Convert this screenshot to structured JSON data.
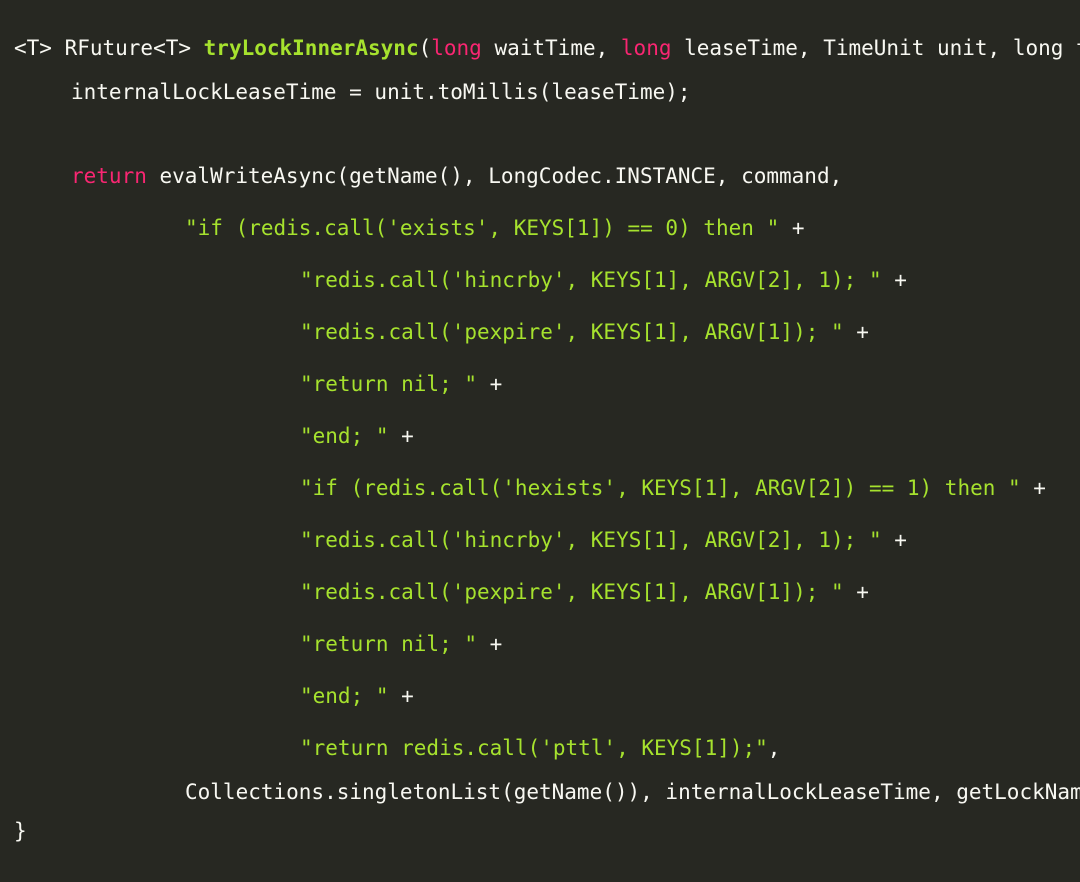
{
  "colors": {
    "background": "#272822",
    "plain": "#f8f8f2",
    "keyword": "#f92672",
    "function": "#a6e22e",
    "string": "#a6e22e"
  },
  "code": {
    "line1": {
      "part1": "<T> RFuture<T> ",
      "fn_name": "tryLockInnerAsync",
      "part2": "(",
      "kw1": "long",
      "part3": " waitTime, ",
      "kw2": "long",
      "part4": " leaseTime, TimeUnit unit, long threadId, RedisStrictCommand<T> command) {"
    },
    "line2": "internalLockLeaseTime = unit.toMillis(leaseTime);",
    "line3": {
      "kw": "return",
      "rest": " evalWriteAsync(getName(), LongCodec.INSTANCE, command,"
    },
    "line4": {
      "str": "\"if (redis.call('exists', KEYS[1]) == 0) then \"",
      "op": " +"
    },
    "line5": {
      "str": "\"redis.call('hincrby', KEYS[1], ARGV[2], 1); \"",
      "op": " +"
    },
    "line6": {
      "str": "\"redis.call('pexpire', KEYS[1], ARGV[1]); \"",
      "op": " +"
    },
    "line7": {
      "str": "\"return nil; \"",
      "op": " +"
    },
    "line8": {
      "str": "\"end; \"",
      "op": " +"
    },
    "line9": {
      "str": "\"if (redis.call('hexists', KEYS[1], ARGV[2]) == 1) then \"",
      "op": " +"
    },
    "line10": {
      "str": "\"redis.call('hincrby', KEYS[1], ARGV[2], 1); \"",
      "op": " +"
    },
    "line11": {
      "str": "\"redis.call('pexpire', KEYS[1], ARGV[1]); \"",
      "op": " +"
    },
    "line12": {
      "str": "\"return nil; \"",
      "op": " +"
    },
    "line13": {
      "str": "\"end; \"",
      "op": " +"
    },
    "line14": {
      "str": "\"return redis.call('pttl', KEYS[1]);\"",
      "op": ","
    },
    "line15": "Collections.singletonList(getName()), internalLockLeaseTime, getLockName(threadId));",
    "line16": "}"
  }
}
